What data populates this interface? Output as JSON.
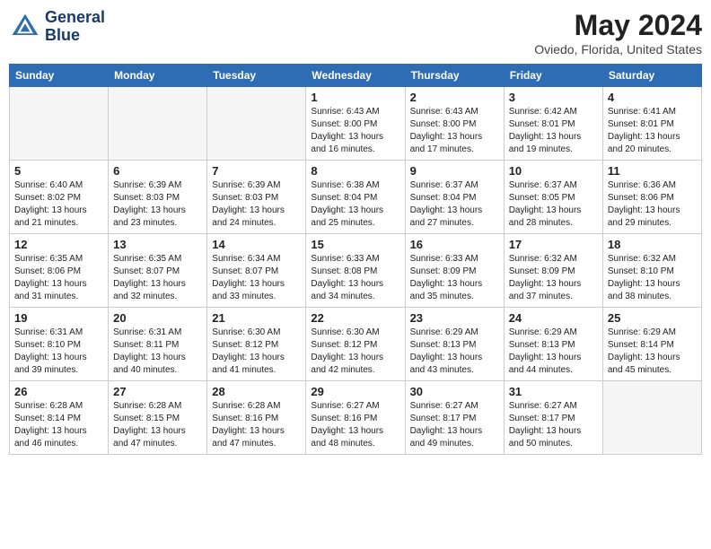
{
  "header": {
    "logo_line1": "General",
    "logo_line2": "Blue",
    "month_year": "May 2024",
    "location": "Oviedo, Florida, United States"
  },
  "days_of_week": [
    "Sunday",
    "Monday",
    "Tuesday",
    "Wednesday",
    "Thursday",
    "Friday",
    "Saturday"
  ],
  "weeks": [
    [
      {
        "day": "",
        "content": ""
      },
      {
        "day": "",
        "content": ""
      },
      {
        "day": "",
        "content": ""
      },
      {
        "day": "1",
        "content": "Sunrise: 6:43 AM\nSunset: 8:00 PM\nDaylight: 13 hours\nand 16 minutes."
      },
      {
        "day": "2",
        "content": "Sunrise: 6:43 AM\nSunset: 8:00 PM\nDaylight: 13 hours\nand 17 minutes."
      },
      {
        "day": "3",
        "content": "Sunrise: 6:42 AM\nSunset: 8:01 PM\nDaylight: 13 hours\nand 19 minutes."
      },
      {
        "day": "4",
        "content": "Sunrise: 6:41 AM\nSunset: 8:01 PM\nDaylight: 13 hours\nand 20 minutes."
      }
    ],
    [
      {
        "day": "5",
        "content": "Sunrise: 6:40 AM\nSunset: 8:02 PM\nDaylight: 13 hours\nand 21 minutes."
      },
      {
        "day": "6",
        "content": "Sunrise: 6:39 AM\nSunset: 8:03 PM\nDaylight: 13 hours\nand 23 minutes."
      },
      {
        "day": "7",
        "content": "Sunrise: 6:39 AM\nSunset: 8:03 PM\nDaylight: 13 hours\nand 24 minutes."
      },
      {
        "day": "8",
        "content": "Sunrise: 6:38 AM\nSunset: 8:04 PM\nDaylight: 13 hours\nand 25 minutes."
      },
      {
        "day": "9",
        "content": "Sunrise: 6:37 AM\nSunset: 8:04 PM\nDaylight: 13 hours\nand 27 minutes."
      },
      {
        "day": "10",
        "content": "Sunrise: 6:37 AM\nSunset: 8:05 PM\nDaylight: 13 hours\nand 28 minutes."
      },
      {
        "day": "11",
        "content": "Sunrise: 6:36 AM\nSunset: 8:06 PM\nDaylight: 13 hours\nand 29 minutes."
      }
    ],
    [
      {
        "day": "12",
        "content": "Sunrise: 6:35 AM\nSunset: 8:06 PM\nDaylight: 13 hours\nand 31 minutes."
      },
      {
        "day": "13",
        "content": "Sunrise: 6:35 AM\nSunset: 8:07 PM\nDaylight: 13 hours\nand 32 minutes."
      },
      {
        "day": "14",
        "content": "Sunrise: 6:34 AM\nSunset: 8:07 PM\nDaylight: 13 hours\nand 33 minutes."
      },
      {
        "day": "15",
        "content": "Sunrise: 6:33 AM\nSunset: 8:08 PM\nDaylight: 13 hours\nand 34 minutes."
      },
      {
        "day": "16",
        "content": "Sunrise: 6:33 AM\nSunset: 8:09 PM\nDaylight: 13 hours\nand 35 minutes."
      },
      {
        "day": "17",
        "content": "Sunrise: 6:32 AM\nSunset: 8:09 PM\nDaylight: 13 hours\nand 37 minutes."
      },
      {
        "day": "18",
        "content": "Sunrise: 6:32 AM\nSunset: 8:10 PM\nDaylight: 13 hours\nand 38 minutes."
      }
    ],
    [
      {
        "day": "19",
        "content": "Sunrise: 6:31 AM\nSunset: 8:10 PM\nDaylight: 13 hours\nand 39 minutes."
      },
      {
        "day": "20",
        "content": "Sunrise: 6:31 AM\nSunset: 8:11 PM\nDaylight: 13 hours\nand 40 minutes."
      },
      {
        "day": "21",
        "content": "Sunrise: 6:30 AM\nSunset: 8:12 PM\nDaylight: 13 hours\nand 41 minutes."
      },
      {
        "day": "22",
        "content": "Sunrise: 6:30 AM\nSunset: 8:12 PM\nDaylight: 13 hours\nand 42 minutes."
      },
      {
        "day": "23",
        "content": "Sunrise: 6:29 AM\nSunset: 8:13 PM\nDaylight: 13 hours\nand 43 minutes."
      },
      {
        "day": "24",
        "content": "Sunrise: 6:29 AM\nSunset: 8:13 PM\nDaylight: 13 hours\nand 44 minutes."
      },
      {
        "day": "25",
        "content": "Sunrise: 6:29 AM\nSunset: 8:14 PM\nDaylight: 13 hours\nand 45 minutes."
      }
    ],
    [
      {
        "day": "26",
        "content": "Sunrise: 6:28 AM\nSunset: 8:14 PM\nDaylight: 13 hours\nand 46 minutes."
      },
      {
        "day": "27",
        "content": "Sunrise: 6:28 AM\nSunset: 8:15 PM\nDaylight: 13 hours\nand 47 minutes."
      },
      {
        "day": "28",
        "content": "Sunrise: 6:28 AM\nSunset: 8:16 PM\nDaylight: 13 hours\nand 47 minutes."
      },
      {
        "day": "29",
        "content": "Sunrise: 6:27 AM\nSunset: 8:16 PM\nDaylight: 13 hours\nand 48 minutes."
      },
      {
        "day": "30",
        "content": "Sunrise: 6:27 AM\nSunset: 8:17 PM\nDaylight: 13 hours\nand 49 minutes."
      },
      {
        "day": "31",
        "content": "Sunrise: 6:27 AM\nSunset: 8:17 PM\nDaylight: 13 hours\nand 50 minutes."
      },
      {
        "day": "",
        "content": ""
      }
    ]
  ]
}
